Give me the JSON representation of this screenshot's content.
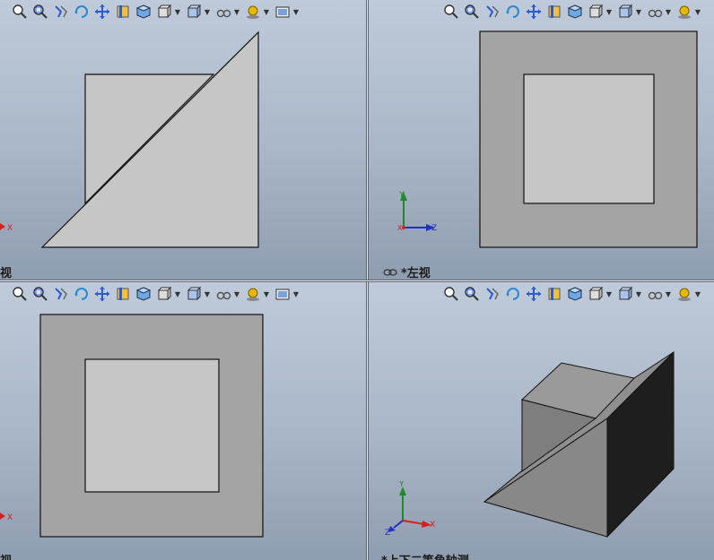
{
  "viewports": {
    "top_left": {
      "label": "视"
    },
    "top_right": {
      "label": "*左视"
    },
    "bottom_left": {
      "label": "视"
    },
    "bottom_right": {
      "label": "*上下二等角轴测"
    }
  },
  "toolbar": {
    "icons": [
      "zoom-to-fit-icon",
      "zoom-area-icon",
      "previous-view-icon",
      "rotate-view-icon",
      "pan-icon",
      "section-view-icon",
      "view-orientation-icon",
      "display-style-icon",
      "hide-show-items-icon",
      "edit-appearance-icon",
      "apply-scene-icon",
      "view-settings-icon"
    ]
  },
  "triad": {
    "x": "X",
    "y": "Y",
    "z": "Z"
  },
  "colors": {
    "viewport_top": "#bfcbda",
    "viewport_bottom": "#8f9db0",
    "face_light": "#c6c6c6",
    "face_dark": "#a4a4a4",
    "face_black": "#1e1e1e",
    "axis_x": "#d62020",
    "axis_y": "#1f8a2a",
    "axis_z": "#2030c0"
  }
}
